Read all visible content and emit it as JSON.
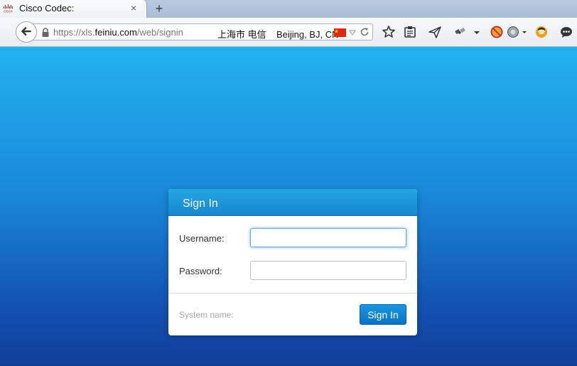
{
  "browser": {
    "tab": {
      "title": "Cisco Codec:",
      "favicon_text": "cisco",
      "close": "×"
    },
    "new_tab": "+",
    "url": {
      "prefix": "https://xls.",
      "domain": "feiniu.com",
      "path": "/web/signin"
    },
    "geo_info": "上海市 电信    Beijing, BJ, CN",
    "icons": [
      "back-arrow-icon",
      "lock-icon",
      "flag-cn-icon",
      "dropmarker-icon",
      "reload-icon",
      "bookmark-star-icon",
      "reading-list-icon",
      "send-icon",
      "satellite-icon",
      "menu-arrow-icon",
      "blocked-addon-icon",
      "addon-globe-icon",
      "avatar-icon",
      "chat-icon"
    ]
  },
  "signin": {
    "title": "Sign In",
    "username_label": "Username:",
    "username_value": "",
    "password_label": "Password:",
    "password_value": "",
    "system_name_label": "System name:",
    "button_label": "Sign In"
  },
  "colors": {
    "page_top": "#22b2ef",
    "page_bottom": "#113e99",
    "header": "#1a94d9",
    "button": "#0a72c2"
  }
}
